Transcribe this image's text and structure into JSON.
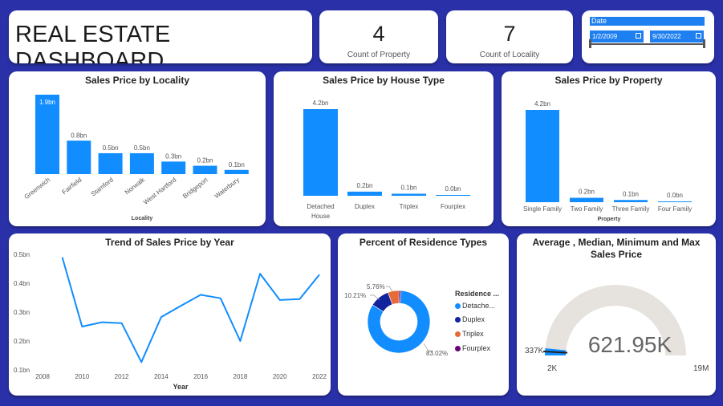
{
  "header": {
    "title": "REAL ESTATE DASHBOARD"
  },
  "kpis": {
    "property": {
      "value": "4",
      "label": "Count of Property"
    },
    "locality": {
      "value": "7",
      "label": "Count of Locality"
    }
  },
  "date_slicer": {
    "title": "Date",
    "start": "1/2/2009",
    "end": "9/30/2022",
    "range_fraction": [
      0,
      1
    ]
  },
  "colors": {
    "bar": "#118dff",
    "gauge_bg": "#e6e2dd",
    "gauge_fill": "#118dff",
    "background": "#2a31a8"
  },
  "chart_data": [
    {
      "id": "locality",
      "type": "bar",
      "title": "Sales Price by Locality",
      "xlabel": "Locality",
      "categories": [
        "Greenwich",
        "Fairfield",
        "Stamford",
        "Norwalk",
        "West Hartford",
        "Bridgeport",
        "Waterbury"
      ],
      "values": [
        1.9,
        0.8,
        0.5,
        0.5,
        0.3,
        0.2,
        0.1
      ],
      "labels": [
        "1.9bn",
        "0.8bn",
        "0.5bn",
        "0.5bn",
        "0.3bn",
        "0.2bn",
        "0.1bn"
      ],
      "unit": "bn"
    },
    {
      "id": "house_type",
      "type": "bar",
      "title": "Sales Price by House Type",
      "xlabel": "",
      "categories": [
        "Detached House",
        "Duplex",
        "Triplex",
        "Fourplex"
      ],
      "values": [
        4.2,
        0.2,
        0.1,
        0.0
      ],
      "labels": [
        "4.2bn",
        "0.2bn",
        "0.1bn",
        "0.0bn"
      ],
      "unit": "bn"
    },
    {
      "id": "property",
      "type": "bar",
      "title": "Sales Price by Property",
      "xlabel": "Property",
      "categories": [
        "Single Family",
        "Two Family",
        "Three Family",
        "Four Family"
      ],
      "values": [
        4.2,
        0.2,
        0.1,
        0.0
      ],
      "labels": [
        "4.2bn",
        "0.2bn",
        "0.1bn",
        "0.0bn"
      ],
      "unit": "bn"
    },
    {
      "id": "trend",
      "type": "line",
      "title": "Trend of Sales Price by Year",
      "xlabel": "Year",
      "x": [
        2009,
        2010,
        2011,
        2012,
        2013,
        2014,
        2015,
        2016,
        2017,
        2018,
        2019,
        2020,
        2021,
        2022
      ],
      "values": [
        0.49,
        0.25,
        0.265,
        0.262,
        0.127,
        0.283,
        0.322,
        0.36,
        0.348,
        0.2,
        0.433,
        0.342,
        0.345,
        0.43
      ],
      "xticks": [
        2008,
        2010,
        2012,
        2014,
        2016,
        2018,
        2020,
        2022
      ],
      "yticks": [
        "0.1bn",
        "0.2bn",
        "0.3bn",
        "0.4bn",
        "0.5bn"
      ],
      "xlim": [
        2008,
        2022
      ],
      "ylim": [
        0.1,
        0.5
      ]
    },
    {
      "id": "residence",
      "type": "pie",
      "title": "Percent of Residence Types",
      "legend_title": "Residence ...",
      "legend": [
        "Detache...",
        "Duplex",
        "Triplex",
        "Fourplex"
      ],
      "values": [
        83.02,
        10.21,
        5.76,
        1.01
      ],
      "labels": [
        "83.02%",
        "10.21%",
        "5.76%",
        ""
      ],
      "colors": [
        "#118dff",
        "#12239e",
        "#e66c37",
        "#6b007b"
      ]
    },
    {
      "id": "gauge",
      "type": "gauge",
      "title": "Average , Median, Minimum and Max Sales Price",
      "value": 621950,
      "value_label": "621.95K",
      "min": 2000,
      "max": 19000000,
      "min_label": "2K",
      "max_label": "19M",
      "target": 337000,
      "target_label": "337K"
    }
  ]
}
